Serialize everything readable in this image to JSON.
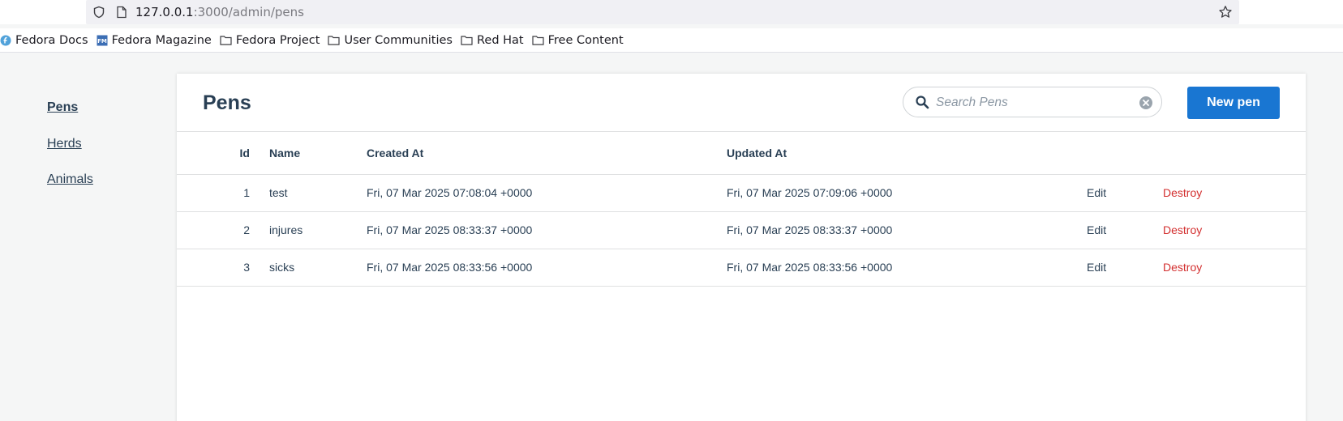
{
  "browser": {
    "url_host": "127.0.0.1",
    "url_path": ":3000/admin/pens",
    "bookmarks": [
      {
        "label": "Fedora Docs",
        "icon": "fedora-icon"
      },
      {
        "label": "Fedora Magazine",
        "icon": "fedora-magazine-icon"
      },
      {
        "label": "Fedora Project",
        "icon": "folder-icon"
      },
      {
        "label": "User Communities",
        "icon": "folder-icon"
      },
      {
        "label": "Red Hat",
        "icon": "folder-icon"
      },
      {
        "label": "Free Content",
        "icon": "folder-icon"
      }
    ]
  },
  "sidebar": {
    "items": [
      {
        "label": "Pens",
        "active": true
      },
      {
        "label": "Herds",
        "active": false
      },
      {
        "label": "Animals",
        "active": false
      }
    ]
  },
  "header": {
    "title": "Pens",
    "search_placeholder": "Search Pens",
    "new_button": "New pen"
  },
  "table": {
    "columns": [
      "Id",
      "Name",
      "Created At",
      "Updated At"
    ],
    "rows": [
      {
        "id": "1",
        "name": "test",
        "created_at": "Fri, 07 Mar 2025 07:08:04 +0000",
        "updated_at": "Fri, 07 Mar 2025 07:09:06 +0000",
        "edit": "Edit",
        "destroy": "Destroy"
      },
      {
        "id": "2",
        "name": "injures",
        "created_at": "Fri, 07 Mar 2025 08:33:37 +0000",
        "updated_at": "Fri, 07 Mar 2025 08:33:37 +0000",
        "edit": "Edit",
        "destroy": "Destroy"
      },
      {
        "id": "3",
        "name": "sicks",
        "created_at": "Fri, 07 Mar 2025 08:33:56 +0000",
        "updated_at": "Fri, 07 Mar 2025 08:33:56 +0000",
        "edit": "Edit",
        "destroy": "Destroy"
      }
    ]
  },
  "colors": {
    "primary": "#1976d2",
    "danger": "#d32f2f",
    "text": "#293f54"
  }
}
